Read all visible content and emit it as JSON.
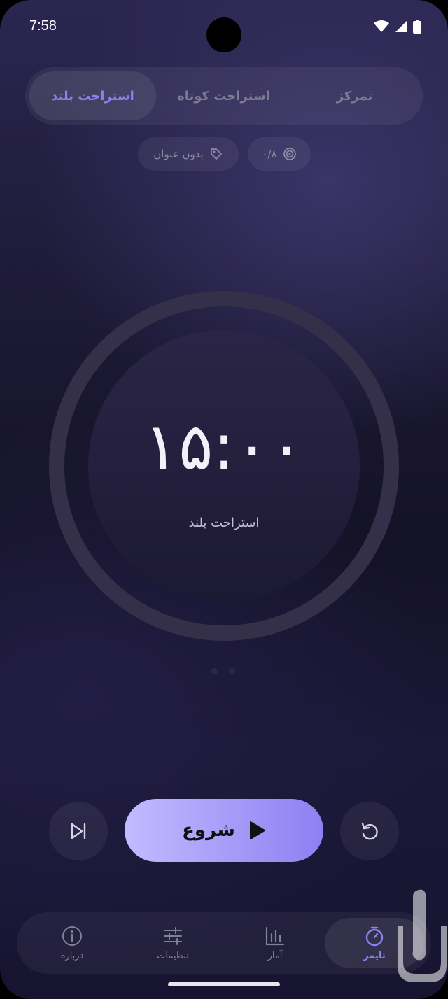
{
  "status_bar": {
    "time": "7:58",
    "icons": [
      "wifi-icon",
      "signal-icon",
      "battery-icon"
    ]
  },
  "tabs": [
    {
      "label": "استراحت بلند",
      "active": true
    },
    {
      "label": "استراحت کوتاه",
      "active": false
    },
    {
      "label": "تمرکز",
      "active": false
    }
  ],
  "chips": {
    "goal": "۰/۸",
    "label": "بدون عنوان"
  },
  "timer": {
    "display": "۱۵:۰۰",
    "mode": "استراحت بلند"
  },
  "controls": {
    "start_label": "شروع"
  },
  "nav": [
    {
      "label": "درباره",
      "icon": "info-icon",
      "active": false
    },
    {
      "label": "تنظیمات",
      "icon": "sliders-icon",
      "active": false
    },
    {
      "label": "آمار",
      "icon": "chart-icon",
      "active": false
    },
    {
      "label": "تایمر",
      "icon": "stopwatch-icon",
      "active": true
    }
  ],
  "colors": {
    "accent": "#8f7ff2",
    "start_gradient": [
      "#c3bbff",
      "#8f7ff2"
    ]
  }
}
